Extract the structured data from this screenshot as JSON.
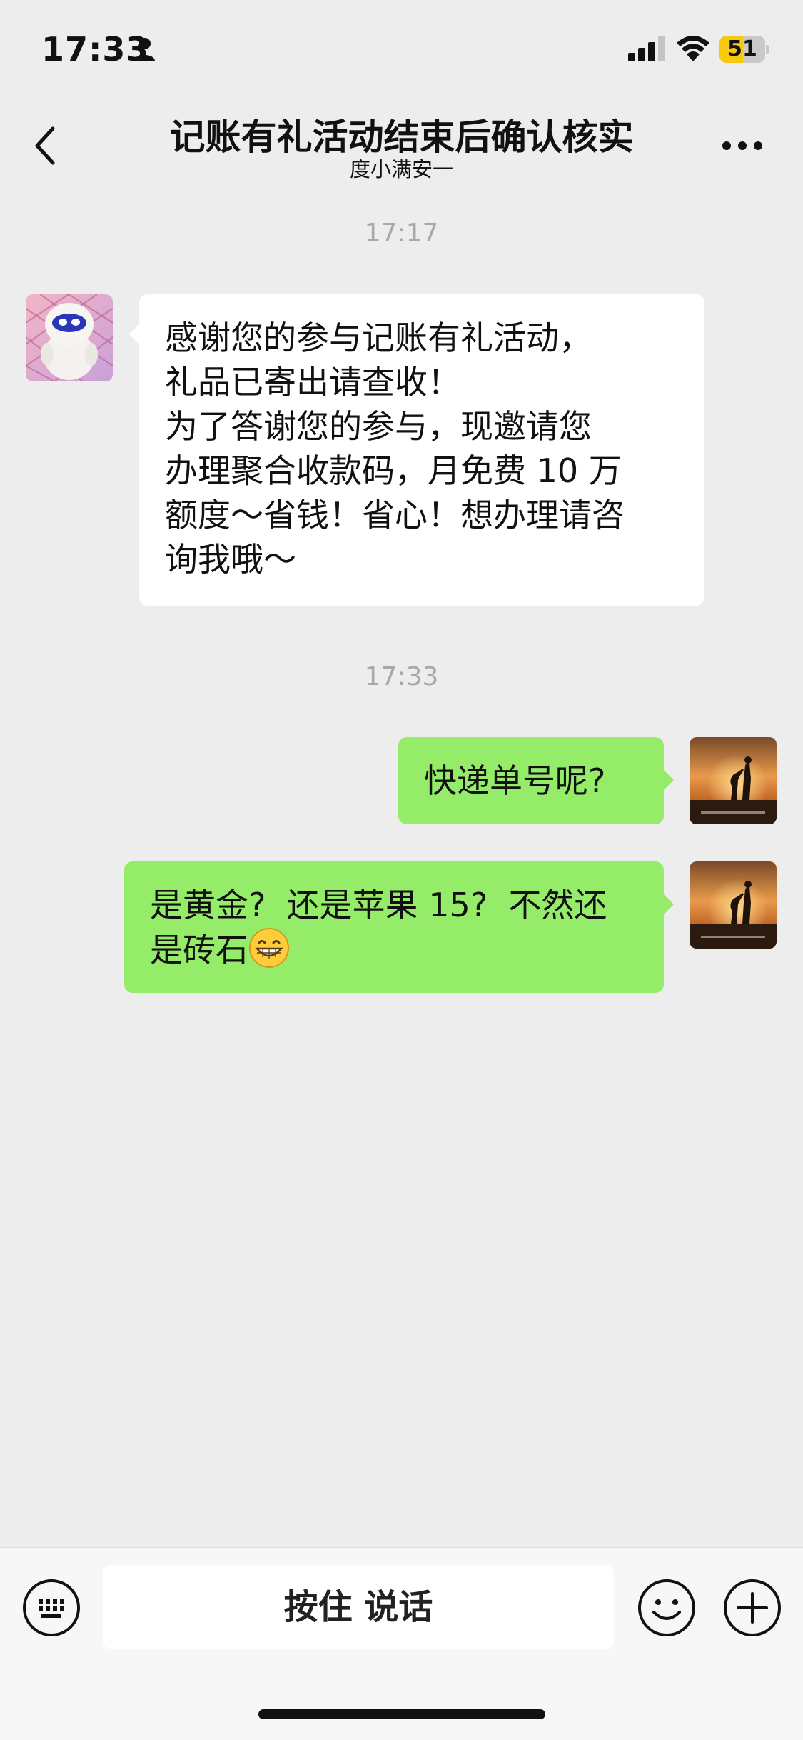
{
  "status_bar": {
    "time": "17:33",
    "battery_level": "51",
    "battery_fraction": 0.51,
    "icons": [
      "person-icon",
      "cellular-signal-icon",
      "wifi-icon",
      "battery-icon"
    ]
  },
  "nav": {
    "title": "记账有礼活动结束后确认核实",
    "subtitle": "度小满安一",
    "back_icon": "chevron-left-icon",
    "more_icon": "more-dots-icon"
  },
  "messages": [
    {
      "type": "timestamp",
      "text": "17:17"
    },
    {
      "type": "incoming",
      "avatar": "white-mascot-avatar",
      "text": "感谢您的参与记账有礼活动，\n礼品已寄出请查收！\n为了答谢您的参与，现邀请您\n办理聚合收款码，月免费 10 万\n额度～省钱！省心！想办理请咨\n询我哦～"
    },
    {
      "type": "timestamp",
      "text": "17:33"
    },
    {
      "type": "outgoing",
      "avatar": "sunset-silhouette-avatar",
      "text": "快递单号呢?"
    },
    {
      "type": "outgoing",
      "avatar": "sunset-silhouette-avatar",
      "text": "是黄金?  还是苹果 15?  不然还\n是砖石",
      "emoji": "grinning-emoji"
    }
  ],
  "input_bar": {
    "hold_to_talk_label": "按住 说话",
    "icons": [
      "keyboard-icon",
      "emoji-icon",
      "plus-icon"
    ]
  },
  "colors": {
    "background": "#ededed",
    "outgoing_bubble": "#95ec69",
    "incoming_bubble": "#ffffff",
    "timestamp": "#a8a8a8",
    "battery": "#f6c90e"
  }
}
